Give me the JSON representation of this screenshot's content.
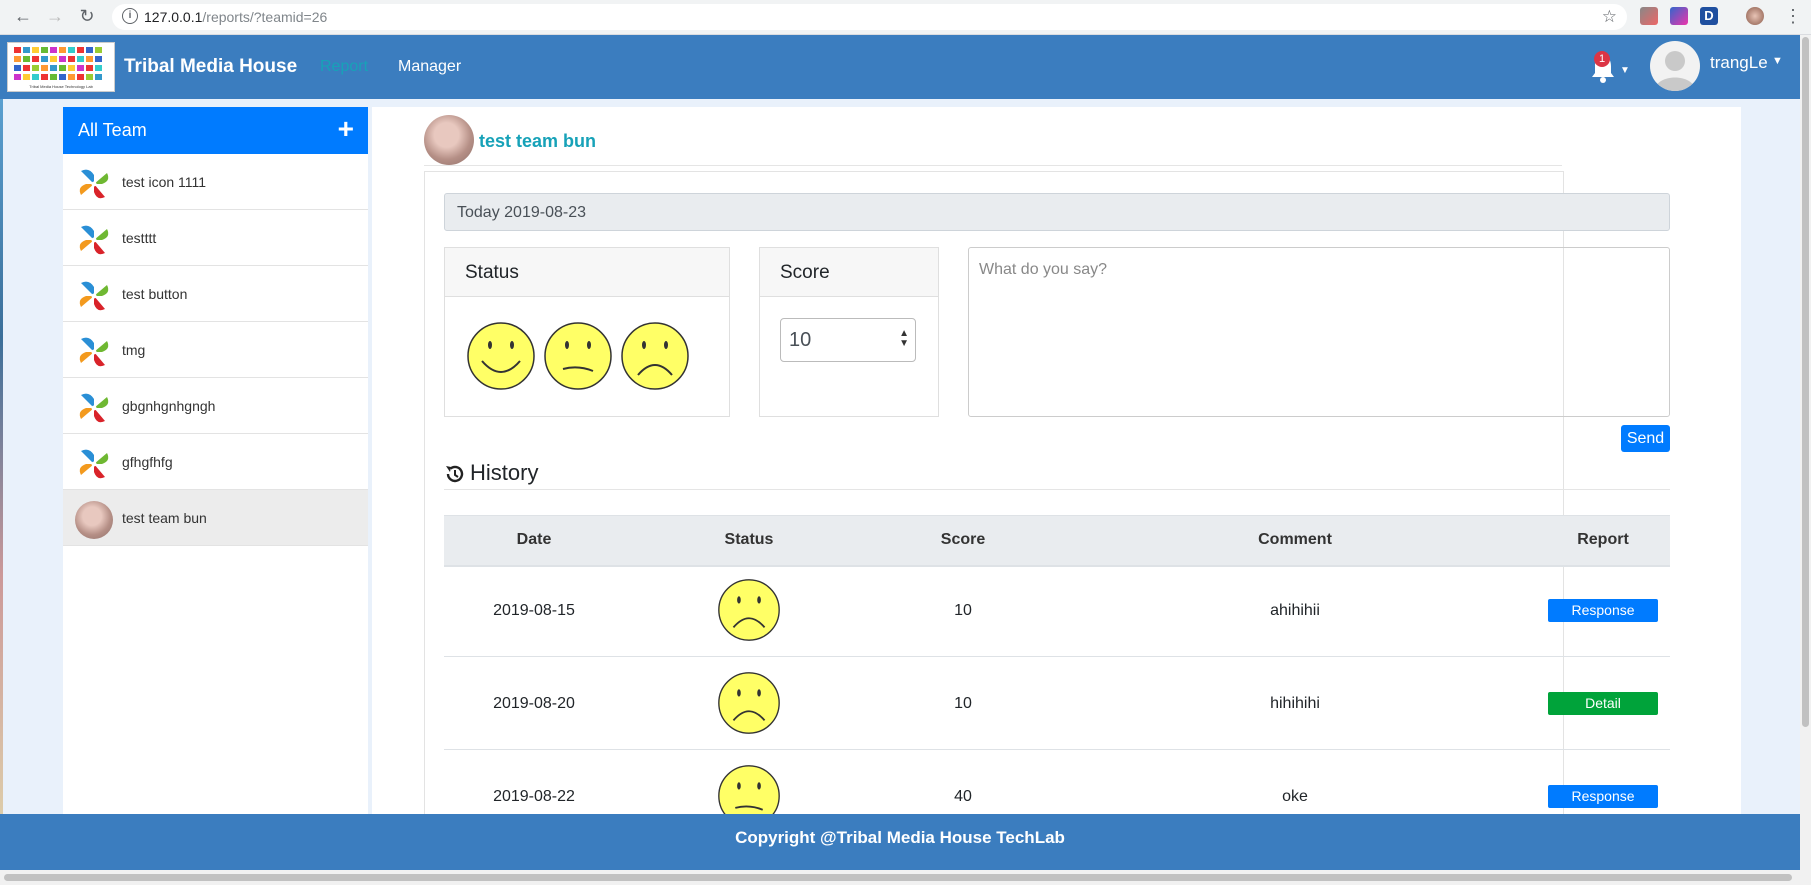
{
  "browser": {
    "url_host": "127.0.0.1",
    "url_path": "/reports/?teamid=26"
  },
  "navbar": {
    "brand": "Tribal Media House",
    "logo_caption": "Tribal Media House Technology Lab",
    "links": [
      "Report",
      "Manager"
    ],
    "notification_count": "1",
    "username": "trangLe"
  },
  "sidebar": {
    "title": "All Team",
    "teams": [
      {
        "name": "test icon 1111",
        "icon": "pinwheel-icon"
      },
      {
        "name": "testttt",
        "icon": "pinwheel-icon"
      },
      {
        "name": "test button",
        "icon": "pinwheel-icon"
      },
      {
        "name": "tmg",
        "icon": "pinwheel-icon"
      },
      {
        "name": "gbgnhgnhgngh",
        "icon": "pinwheel-icon"
      },
      {
        "name": "gfhgfhfg",
        "icon": "pinwheel-icon"
      },
      {
        "name": "test team bun",
        "icon": "baby-photo-avatar",
        "active": true
      }
    ]
  },
  "main": {
    "team_name": "test team bun",
    "today_label": "Today 2019-08-23",
    "status_title": "Status",
    "status_options": [
      "happy-face-icon",
      "neutral-face-icon",
      "sad-face-icon"
    ],
    "score_title": "Score",
    "score_value": "10",
    "comment_placeholder": "What do you say?",
    "send_label": "Send",
    "history_title": "History",
    "table": {
      "headers": [
        "Date",
        "Status",
        "Score",
        "Comment",
        "Report"
      ],
      "rows": [
        {
          "date": "2019-08-15",
          "status": "sad-face-icon",
          "score": "10",
          "comment": "ahihihii",
          "report": "Response",
          "report_color": "#007bff"
        },
        {
          "date": "2019-08-20",
          "status": "sad-face-icon",
          "score": "10",
          "comment": "hihihihi",
          "report": "Detail",
          "report_color": "#00a33a"
        },
        {
          "date": "2019-08-22",
          "status": "neutral-face-icon",
          "score": "40",
          "comment": "oke",
          "report": "Response",
          "report_color": "#007bff"
        }
      ]
    }
  },
  "footer": {
    "text": "Copyright @Tribal Media House TechLab"
  },
  "colors": {
    "navbar": "#3b7dbf",
    "primary": "#007bff",
    "accent": "#17a2b8",
    "smiley": "#ffff66"
  }
}
